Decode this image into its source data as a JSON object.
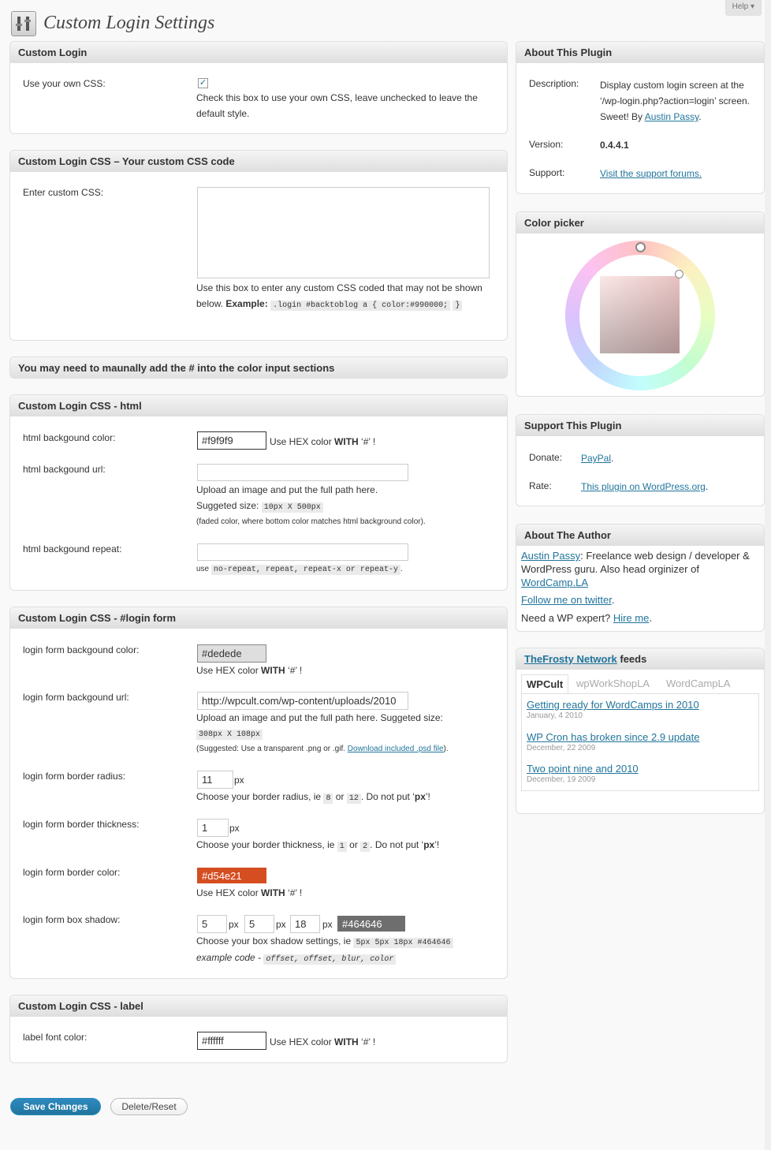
{
  "help_tab": "Help",
  "page_title": "Custom Login Settings",
  "custom_login": {
    "title": "Custom Login",
    "use_css_label": "Use your own CSS:",
    "use_css_checked": true,
    "use_css_desc": "Check this box to use your own CSS, leave unchecked to leave the default style."
  },
  "custom_css": {
    "title": "Custom Login CSS – Your custom CSS code",
    "label": "Enter custom CSS:",
    "value": "",
    "desc": "Use this box to enter any custom CSS coded that may not be shown below.",
    "example_label": "Example:",
    "example_code_1": ".login #backtoblog a { color:#990000;",
    "example_code_2": "}"
  },
  "notice": "You may need to maunally add the # into the color input sections",
  "html_section": {
    "title": "Custom Login CSS - html",
    "bg_color_label": "html backgound color:",
    "bg_color_value": "#f9f9f9",
    "hex_note_prefix": "Use HEX color ",
    "hex_note_bold": "WITH",
    "hex_note_suffix": " ‘#’ !",
    "bg_url_label": "html backgound url:",
    "bg_url_value": "",
    "bg_url_desc": "Upload an image and put the full path here.",
    "size_prefix": "Suggeted size: ",
    "size_code": "10px X 500px",
    "faded_note": "(faded color, where bottom color matches html background color).",
    "repeat_label": "html backgound repeat:",
    "repeat_value": "",
    "repeat_use": "use",
    "repeat_code": "no-repeat, repeat, repeat-x or repeat-y",
    "repeat_end": "."
  },
  "login_form": {
    "title": "Custom Login CSS - #login form",
    "bg_color_label": "login form backgound color:",
    "bg_color_value": "#dedede",
    "bg_color_swatch": "#dedede",
    "hex_note_prefix": "Use HEX color ",
    "hex_note_bold": "WITH",
    "hex_note_suffix": " ‘#’ !",
    "bg_url_label": "login form backgound url:",
    "bg_url_value": "http://wpcult.com/wp-content/uploads/2010",
    "bg_url_desc": "Upload an image and put the full path here. Suggeted size:",
    "bg_size_code": "308px X 108px",
    "suggest_prefix": "(Suggested: Use a transparent .png or .gif. ",
    "suggest_link": "Download included .psd file",
    "suggest_suffix": ").",
    "radius_label": "login form border radius:",
    "radius_value": "11",
    "px": "px",
    "radius_desc_prefix": "Choose your border radius, ie",
    "radius_code_a": "8",
    "or": "or",
    "radius_code_b": "12",
    "no_px_prefix": ". Do not put ‘",
    "no_px_bold": "px",
    "no_px_suffix": "’!",
    "thickness_label": "login form border thickness:",
    "thickness_value": "1",
    "thickness_desc_prefix": "Choose your border thickness, ie",
    "thickness_code_a": "1",
    "thickness_code_b": "2",
    "border_color_label": "login form border color:",
    "border_color_value": "#d54e21",
    "border_color_swatch": "#d54e21",
    "shadow_label": "login form box shadow:",
    "shadow_x": "5",
    "shadow_y": "5",
    "shadow_blur": "18",
    "shadow_color": "#464646",
    "shadow_color_swatch": "#6e6e6e",
    "shadow_desc_prefix": "Choose your box shadow settings, ie",
    "shadow_code": "5px 5px 18px #464646",
    "example_code_label": "example code -",
    "example_code_value": "offset, offset, blur, color"
  },
  "label_section": {
    "title": "Custom Login CSS - label",
    "font_color_label": "label font color:",
    "font_color_value": "#ffffff"
  },
  "buttons": {
    "save": "Save Changes",
    "reset": "Delete/Reset"
  },
  "about_plugin": {
    "title": "About This Plugin",
    "desc_label": "Description:",
    "desc_text": "Display custom login screen at the ‘/wp-login.php?action=login’ screen. Sweet! By",
    "desc_author": "Austin Passy",
    "desc_end": ".",
    "version_label": "Version:",
    "version_value": "0.4.4.1",
    "support_label": "Support:",
    "support_link": "Visit the support forums."
  },
  "color_picker": {
    "title": "Color picker"
  },
  "support_plugin": {
    "title": "Support This Plugin",
    "donate_label": "Donate:",
    "donate_link": "PayPal",
    "rate_label": "Rate:",
    "rate_link": "This plugin on WordPress.org",
    "dot": "."
  },
  "about_author": {
    "title": "About The Author",
    "author_link": "Austin Passy",
    "bio": ": Freelance web design / developer & WordPress guru. Also head orginizer of ",
    "wordcamp_link": "WordCamp.LA",
    "twitter_link": "Follow me on twitter",
    "twitter_end": ".",
    "expert_text": "Need a WP expert? ",
    "hire_link": "Hire me",
    "hire_end": "."
  },
  "feeds": {
    "network_link": "TheFrosty Network",
    "title_suffix": " feeds",
    "tabs": [
      "WPCult",
      "wpWorkShopLA",
      "WordCampLA"
    ],
    "active_tab": 0,
    "items": [
      {
        "title": "Getting ready for WordCamps in 2010",
        "date": "January, 4 2010"
      },
      {
        "title": "WP Cron has broken since 2.9 update",
        "date": "December, 22 2009"
      },
      {
        "title": "Two point nine and 2010",
        "date": "December, 19 2009"
      }
    ]
  }
}
